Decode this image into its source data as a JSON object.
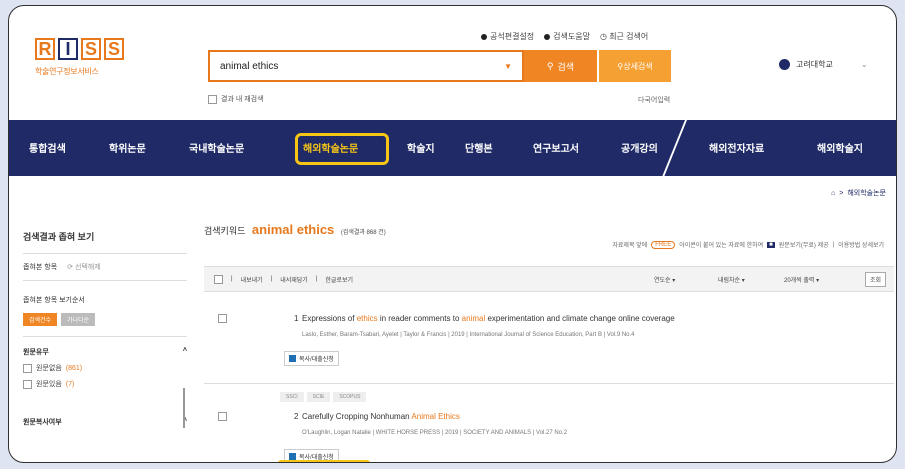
{
  "logo": {
    "letters": [
      "R",
      "I",
      "S",
      "S"
    ],
    "subtitle": "학술연구정보서비스"
  },
  "top_links": [
    "공석편결설정",
    "검색도움말",
    "최근 검색어"
  ],
  "search": {
    "value": "animal ethics",
    "button": "검색",
    "detail_button": "상세검색",
    "result_in_label": "결과 내 재검색",
    "multilang": "다국어입력"
  },
  "user": {
    "name": "고려대학교"
  },
  "nav": [
    "통합검색",
    "학위논문",
    "국내학술논문",
    "해외학술논문",
    "학술지",
    "단행본",
    "연구보고서",
    "공개강의",
    "해외전자자료",
    "해외학술지"
  ],
  "breadcrumb": "해외학술논문",
  "sidebar": {
    "title": "검색결과 좁혀 보기",
    "narrow_label": "좁혀본 항목",
    "reset_label": "선택해제",
    "order_label": "좁혀본 항목 보기순서",
    "order_options": [
      "검색건수",
      "가나다순"
    ],
    "facet1": {
      "title": "원문유무",
      "options": [
        {
          "label": "원문없음",
          "count": "(861)"
        },
        {
          "label": "원문있음",
          "count": "(7)"
        }
      ]
    },
    "facet2": {
      "title": "원문복사여부"
    }
  },
  "results": {
    "keyword_label": "검색키워드",
    "keyword": "animal ethics",
    "count_text": "(검색결과 868 건)",
    "notice_prefix": "자료제목 앞에",
    "notice_fr": "FREE",
    "notice_mid": "아이콘이 붙어 있는 자료에 한하여",
    "notice_open": "원문보기(무료) 제공",
    "notice_guide": "이용방법 상세보기",
    "toolbar": [
      "내보내기",
      "내서재담기",
      "한글로보기"
    ],
    "sort": [
      "연도순",
      "내림차순",
      "20개씩 출력"
    ],
    "go": "조회",
    "items": [
      {
        "num": "1",
        "title_a": "Expressions of ",
        "title_b": "ethics",
        "title_c": " in reader comments to ",
        "title_d": "animal",
        "title_e": " experimentation and climate change online coverage",
        "meta": "Laslo, Esther, Baram-Tsabari, Ayelet  |  Taylor & Francis  |  2019  |  International Journal of Science Education, Part B  |  Vol.9 No.4",
        "req": "복사/대출신청"
      },
      {
        "num": "2",
        "title_a": "Carefully Cropping Nonhuman ",
        "title_b": "Animal Ethics",
        "title_c": "",
        "title_d": "",
        "title_e": "",
        "meta": "O'Laughlin, Logan Natalie  |  WHITE HORSE PRESS  |  2019  |  SOCIETY AND ANIMALS  |  Vol.27 No.2",
        "req": "복사/대출신청",
        "tags": [
          "SSCI",
          "SCIE",
          "SCOPUS"
        ]
      }
    ]
  }
}
